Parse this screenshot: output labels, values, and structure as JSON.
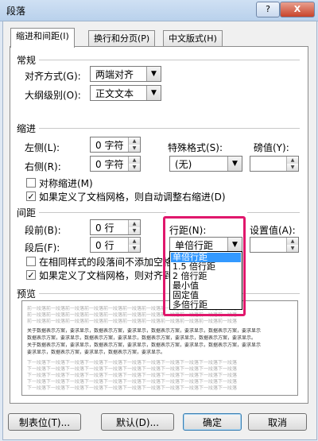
{
  "window": {
    "title": "段落",
    "help_label": "?",
    "close_label": "X"
  },
  "tabs": [
    {
      "label": "缩进和间距(I)",
      "active": true
    },
    {
      "label": "换行和分页(P)",
      "active": false
    },
    {
      "label": "中文版式(H)",
      "active": false
    }
  ],
  "general": {
    "heading": "常规",
    "alignment_label": "对齐方式(G):",
    "alignment_value": "两端对齐",
    "outline_label": "大纲级别(O):",
    "outline_value": "正文文本"
  },
  "indent": {
    "heading": "缩进",
    "left_label": "左侧(L):",
    "left_value": "0 字符",
    "right_label": "右侧(R):",
    "right_value": "0 字符",
    "special_label": "特殊格式(S):",
    "special_value": "(无)",
    "by_label": "磅值(Y):",
    "mirror_label": "对称缩进(M)",
    "mirror_checked": false,
    "grid_adjust_label": "如果定义了文档网格，则自动调整右缩进(D)",
    "grid_adjust_checked": true
  },
  "spacing": {
    "heading": "间距",
    "before_label": "段前(B):",
    "before_value": "0 行",
    "after_label": "段后(F):",
    "after_value": "0 行",
    "line_label": "行距(N):",
    "line_value": "单倍行距",
    "at_label": "设置值(A):",
    "no_space_label": "在相同样式的段落间不添加空格",
    "no_space_checked": false,
    "snap_grid_label": "如果定义了文档网格，则对齐到",
    "snap_grid_checked": true,
    "line_options": [
      "单倍行距",
      "1.5 倍行距",
      "2 倍行距",
      "最小值",
      "固定值",
      "多倍行距"
    ],
    "selected_option_index": 0
  },
  "preview": {
    "heading": "预览",
    "prev_text": "前一段落前一段落前一段落前一段落前一段落前一段落前一段落前一段落前一段落前一段落前一段落",
    "sample_text_1": "关于数据表示方案，要求显示，数据表示方案，要求显示，数据表示方案，要求显示，数据表示方案，要求显示",
    "sample_text_2": "数据表示方案，要求显示，数据表示方案，要求显示，数据表示方案，要求显示，数据表示方案，要求显示。",
    "sample_text_3": "要求显示，数据表示方案，要求显示，数据表示方案，要求显示。",
    "next_text": "下一段落下一段落下一段落下一段落下一段落下一段落下一段落下一段落下一段落下一段落下一段落"
  },
  "buttons": {
    "tabs_label": "制表位(T)...",
    "default_label": "默认(D)...",
    "ok_label": "确定",
    "cancel_label": "取消"
  },
  "icons": {
    "dropdown": "chevron-down-icon",
    "spin_up": "arrow-up-icon",
    "spin_down": "arrow-down-icon",
    "check": "checkmark-icon"
  },
  "colors": {
    "highlight": "#e0176c",
    "selection": "#3399ff",
    "title_bar": "#b9d1ec"
  }
}
